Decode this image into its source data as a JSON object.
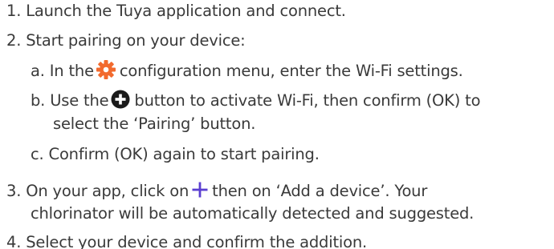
{
  "steps": {
    "s1": {
      "number": "1.",
      "text": "Launch the Tuya application and connect."
    },
    "s2": {
      "number": "2.",
      "text": "Start pairing on your device:",
      "sub_a": {
        "letter": "a.",
        "before_icon": "In the",
        "icon": "gear-icon",
        "after_icon": "configuration menu, enter the Wi-Fi settings."
      },
      "sub_b": {
        "letter": "b.",
        "before_icon": "Use the",
        "icon": "plus-circle-icon",
        "after_icon": "button to activate Wi-Fi, then confirm (OK) to",
        "line2": "select the ‘Pairing’ button."
      },
      "sub_c": {
        "letter": "c.",
        "text": "Confirm (OK) again to start pairing."
      }
    },
    "s3": {
      "number": "3.",
      "before_icon": "On your app, click on",
      "icon": "plus-icon",
      "after_icon": "then on ‘Add a device’. Your",
      "line2": "chlorinator will be automatically detected and suggested."
    },
    "s4": {
      "number": "4.",
      "text": "Select your device and confirm the addition."
    }
  },
  "colors": {
    "text": "#3a3a3a",
    "gear": "#f26a2e",
    "icon_dark": "#1a1a1a",
    "plus_purple": "#5b3fd1"
  }
}
